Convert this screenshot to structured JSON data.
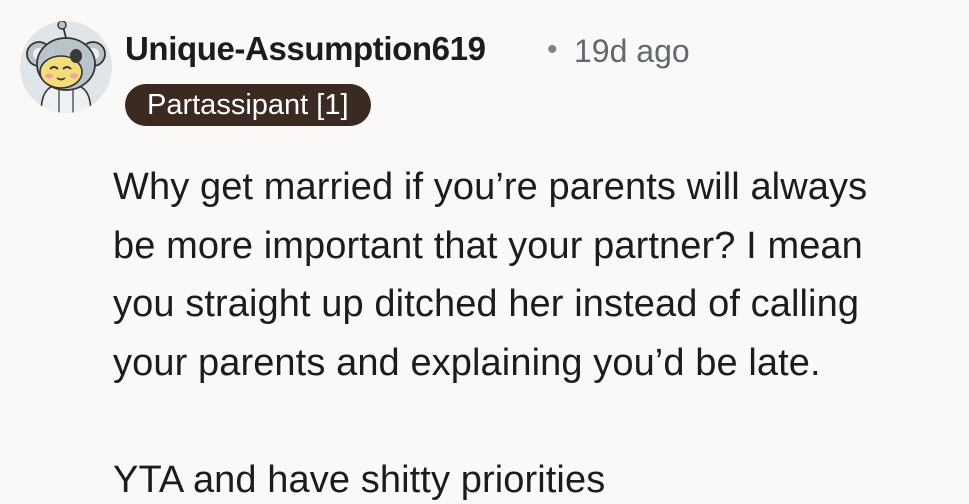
{
  "comment": {
    "author": "Unique-Assumption619",
    "separator": "•",
    "age": "19d ago",
    "flair": "Partassipant [1]",
    "avatar_icon": "koala-snoo-avatar-icon",
    "paragraphs": [
      "Why get married if you’re parents will always\nbe more important that your partner? I mean\nyou straight up ditched her instead of calling\nyour parents and explaining you’d be late.",
      "YTA and have shitty priorities"
    ]
  },
  "colors": {
    "background": "#fbf9f8",
    "text": "#1c1c1c",
    "meta": "#5f6a70",
    "flair_bg": "#3b2a22",
    "flair_text": "#ffffff"
  }
}
